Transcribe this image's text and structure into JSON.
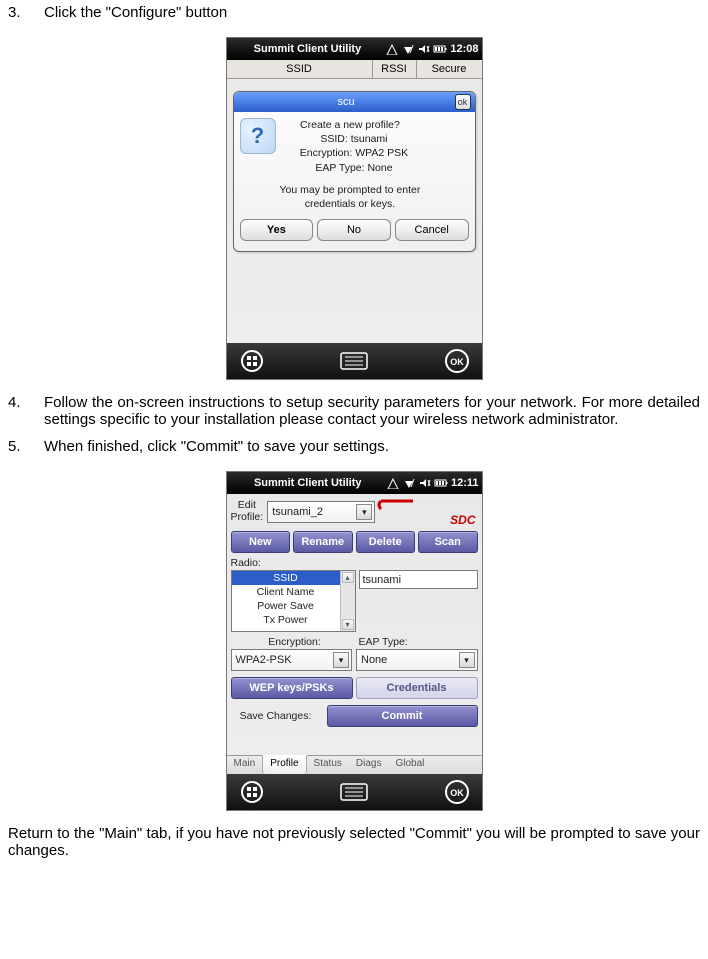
{
  "steps": {
    "s3": {
      "num": "3.",
      "text": "Click the \"Configure\" button"
    },
    "s4": {
      "num": "4.",
      "text": "Follow the on-screen instructions to setup security parameters for your network. For more detailed settings specific to your installation please contact your wireless network administrator."
    },
    "s5": {
      "num": "5.",
      "text": "When finished, click \"Commit\" to save your settings."
    }
  },
  "footer_text": "Return to the \"Main\" tab, if you have not previously selected \"Commit\" you will be prompted to save your changes.",
  "shot1": {
    "title": "Summit Client Utility",
    "time": "12:08",
    "headers": {
      "c1": "SSID",
      "c2": "RSSI",
      "c3": "Secure"
    },
    "dialog": {
      "title": "scu",
      "line1": "Create a new profile?",
      "line2": "SSID: tsunami",
      "line3": "Encryption: WPA2 PSK",
      "line4": "EAP Type: None",
      "line5": "You may be prompted to enter",
      "line6": "credentials or keys.",
      "yes": "Yes",
      "no": "No",
      "cancel": "Cancel"
    }
  },
  "shot2": {
    "title": "Summit Client Utility",
    "time": "12:11",
    "edit_label1": "Edit",
    "edit_label2": "Profile:",
    "profile_name": "tsunami_2",
    "logo": "SDC",
    "btns": {
      "new": "New",
      "rename": "Rename",
      "delete": "Delete",
      "scan": "Scan"
    },
    "radio_label": "Radio:",
    "list": {
      "i1": "SSID",
      "i2": "Client Name",
      "i3": "Power Save",
      "i4": "Tx Power"
    },
    "ssid_value": "tsunami",
    "enc_label": "Encryption:",
    "eap_label": "EAP Type:",
    "enc_value": "WPA2-PSK",
    "eap_value": "None",
    "wep_btn": "WEP keys/PSKs",
    "cred_btn": "Credentials",
    "save_label": "Save Changes:",
    "commit": "Commit",
    "tabs": {
      "t1": "Main",
      "t2": "Profile",
      "t3": "Status",
      "t4": "Diags",
      "t5": "Global"
    }
  }
}
